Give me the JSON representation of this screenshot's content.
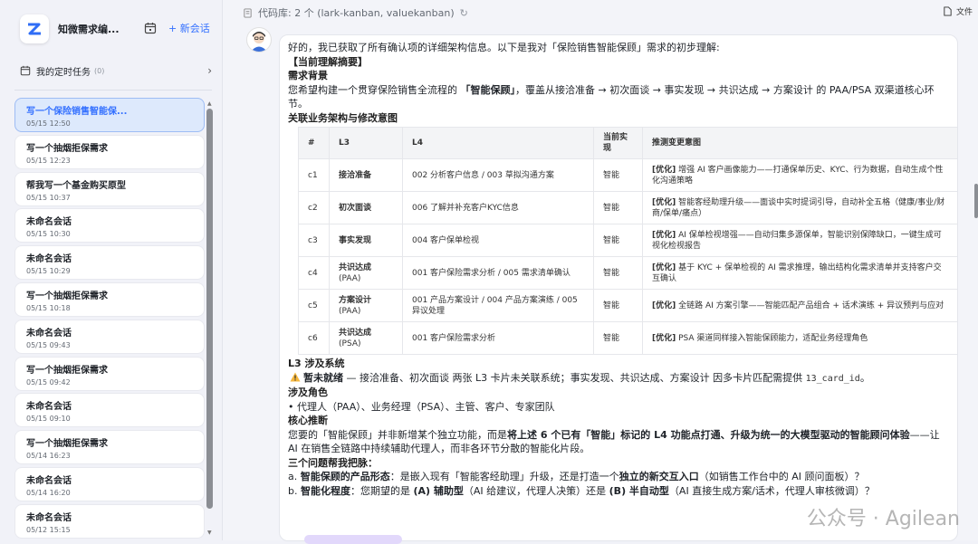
{
  "sidebar": {
    "app_name": "知微需求编...",
    "new_chat_label": "+ 新会话",
    "scheduled": {
      "label": "我的定时任务",
      "count": "(0)"
    },
    "conversations": [
      {
        "title": "写一个保险销售智能保...",
        "date": "05/15 12:50",
        "active": true
      },
      {
        "title": "写一个抽烟拒保需求",
        "date": "05/15 12:23"
      },
      {
        "title": "帮我写一个基金购买原型",
        "date": "05/15 10:37"
      },
      {
        "title": "未命名会话",
        "date": "05/15 10:30"
      },
      {
        "title": "未命名会话",
        "date": "05/15 10:29"
      },
      {
        "title": "写一个抽烟拒保需求",
        "date": "05/15 10:18"
      },
      {
        "title": "未命名会话",
        "date": "05/15 09:43"
      },
      {
        "title": "写一个抽烟拒保需求",
        "date": "05/15 09:42"
      },
      {
        "title": "未命名会话",
        "date": "05/15 09:10"
      },
      {
        "title": "写一个抽烟拒保需求",
        "date": "05/14 16:23"
      },
      {
        "title": "未命名会话",
        "date": "05/14 16:20"
      },
      {
        "title": "未命名会话",
        "date": "05/12 15:15"
      }
    ]
  },
  "header": {
    "repos": "代码库: 2 个 (lark-kanban, valuekanban)",
    "files_label": "文件"
  },
  "message": {
    "intro": "好的，我已获取了所有确认项的详细架构信息。以下是我对「保险销售智能保顾」需求的初步理解:",
    "summary_title": "【当前理解摘要】",
    "bg_title": "需求背景",
    "bg_prefix": "您希望构建一个贯穿保险销售全流程的 ",
    "bg_bold": "「智能保顾」",
    "bg_suffix": "，覆盖从接洽准备 → 初次面谈 → 事实发现 → 共识达成 → 方案设计 的 PAA/PSA 双渠道核心环节。",
    "arch_title": "关联业务架构与修改意图",
    "table_headers": [
      "#",
      "L3",
      "L4",
      "当前实现",
      "推测变更意图"
    ],
    "rows": [
      {
        "id": "c1",
        "l3": "接洽准备",
        "l3b": "",
        "l4": "002 分析客户信息 / 003 草拟沟通方案",
        "impl": "智能",
        "tag": "[优化]",
        "intent": " 增强 AI 客户画像能力——打通保单历史、KYC、行为数据，自动生成个性化沟通策略"
      },
      {
        "id": "c2",
        "l3": "初次面谈",
        "l3b": "",
        "l4": "006 了解并补充客户KYC信息",
        "impl": "智能",
        "tag": "[优化]",
        "intent": " 智能客经助理升级——面谈中实时提词引导，自动补全五格（健康/事业/财商/保单/痛点）"
      },
      {
        "id": "c3",
        "l3": "事实发现",
        "l3b": "",
        "l4": "004 客户保单检视",
        "impl": "智能",
        "tag": "[优化]",
        "intent": " AI 保单检视增强——自动归集多源保单，智能识别保障缺口，一键生成可视化检视报告"
      },
      {
        "id": "c4",
        "l3": "共识达成",
        "l3b": "(PAA)",
        "l4": "001 客户保险需求分析 / 005 需求清单确认",
        "impl": "智能",
        "tag": "[优化]",
        "intent": " 基于 KYC + 保单检视的 AI 需求推理，输出结构化需求清单并支持客户交互确认"
      },
      {
        "id": "c5",
        "l3": "方案设计",
        "l3b": "(PAA)",
        "l4": "001 产品方案设计 / 004 产品方案演练 / 005 异议处理",
        "impl": "智能",
        "tag": "[优化]",
        "intent": " 全链路 AI 方案引擎——智能匹配产品组合 + 话术演练 + 异议预判与应对"
      },
      {
        "id": "c6",
        "l3": "共识达成",
        "l3b": "(PSA)",
        "l4": "001 客户保险需求分析",
        "impl": "智能",
        "tag": "[优化]",
        "intent": " PSA 渠道同样接入智能保顾能力，适配业务经理角色"
      }
    ],
    "l3_sys_title": "L3 涉及系统",
    "warn_bold": "暂未就绪",
    "warn_text": " — 接洽准备、初次面谈 两张 L3 卡片未关联系统；事实发现、共识达成、方案设计 因多卡片匹配需提供 ",
    "warn_code": "13_card_id",
    "warn_end": "。",
    "roles_title": "涉及角色",
    "roles_text": "代理人（PAA）、业务经理（PSA）、主管、客户、专家团队",
    "core_title": "核心推断",
    "core_pre": "您要的「智能保顾」并非新增某个独立功能，而是",
    "core_bold": "将上述 6 个已有「智能」标记的 L4 功能点打通、升级为统一的大模型驱动的智能顾问体验",
    "core_post": "——让 AI 在销售全链路中持续辅助代理人，而非各环节分散的智能化片段。",
    "q_title": "三个问题帮我把脉：",
    "q_a_pre": "a. ",
    "q_a_b1": "智能保顾的产品形态",
    "q_a_mid": "：是嵌入现有「智能客经助理」升级，还是打造一个",
    "q_a_b2": "独立的新交互入口",
    "q_a_post": "（如销售工作台中的 AI 顾问面板）？",
    "q_b_pre": "b. ",
    "q_b_b1": "智能化程度",
    "q_b_mid": "：您期望的是 ",
    "q_b_b2": "(A) 辅助型",
    "q_b_mid2": "（AI 给建议，代理人决策）还是 ",
    "q_b_b3": "(B) 半自动型",
    "q_b_post": "（AI 直接生成方案/话术，代理人审核微调）？"
  },
  "watermark": "公众号 · Agilean"
}
